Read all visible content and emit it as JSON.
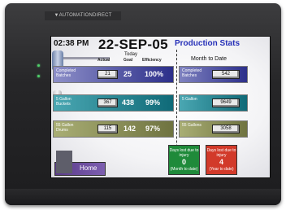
{
  "device": {
    "brand": "AUTOMATIONDIRECT"
  },
  "header": {
    "time": "02:38 PM",
    "date": "22-SEP-05",
    "title": "Production Stats"
  },
  "today": {
    "label": "Today",
    "col_actual": "Actual",
    "col_goal": "Goal",
    "col_efficiency": "Efficiency"
  },
  "month_to_date": {
    "label": "Month to Date"
  },
  "rows": [
    {
      "label": "Completed Batches",
      "actual": "21",
      "goal": "25",
      "efficiency": "100%",
      "mtd": "542",
      "color": "#2c2f8a"
    },
    {
      "label": "5 Gallon Buckets",
      "actual": "367",
      "goal": "438",
      "efficiency": "99%",
      "mtd": "9649",
      "color": "#0f6a78"
    },
    {
      "label": "55 Gallon Drums",
      "actual": "115",
      "goal": "142",
      "efficiency": "97%",
      "mtd": "3058",
      "color": "#6f7340"
    }
  ],
  "mtd_labels": [
    "Completed Batches",
    "5 Gallon",
    "55 Gallons"
  ],
  "days_lost": [
    {
      "title": "Days lost due to injury",
      "value": "0",
      "period": "(Month to date)",
      "color": "#1f8a3a"
    },
    {
      "title": "Days lost due to injury",
      "value": "4",
      "period": "(Year to date)",
      "color": "#d23a2a"
    }
  ],
  "home": {
    "label": "Home"
  }
}
